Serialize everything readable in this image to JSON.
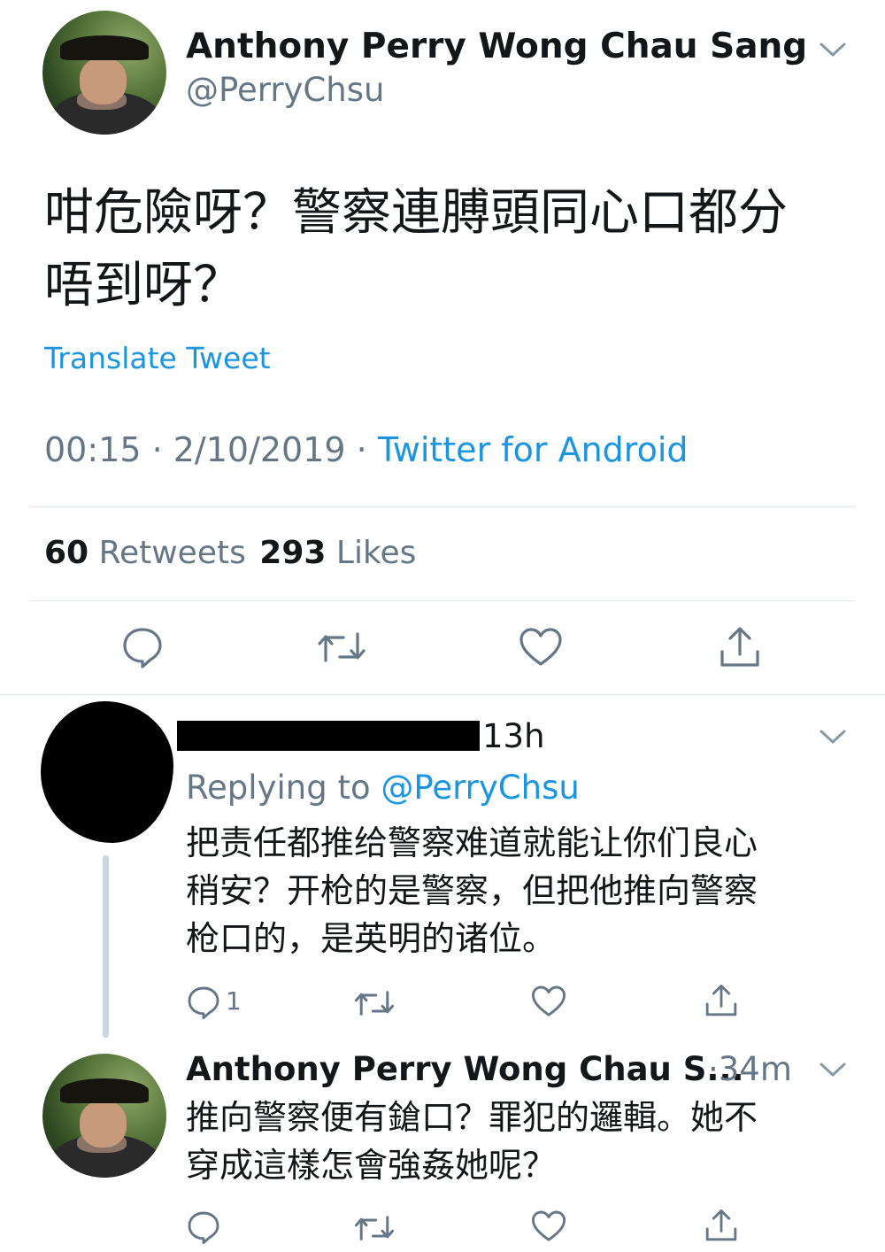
{
  "main_tweet": {
    "author_name": "Anthony Perry Wong Chau Sang",
    "handle": "@PerryChsu",
    "text_line1": "咁危險呀？警察連膊頭同心口都分",
    "text_line2": "唔到呀？",
    "translate_label": "Translate Tweet",
    "timestamp": "00:15 · 2/10/2019 · ",
    "source": "Twitter for Android",
    "retweets_count": "60",
    "retweets_label": "Retweets",
    "likes_count": "293",
    "likes_label": "Likes"
  },
  "reply_1": {
    "time": "13h",
    "replying_to_label": "Replying to ",
    "replying_to_handle": "@PerryChsu",
    "text_line1": "把责任都推给警察难道就能让你们良心",
    "text_line2": "稍安？开枪的是警察，但把他推向警察",
    "text_line3": "枪口的，是英明的诸位。",
    "reply_count": "1"
  },
  "reply_2": {
    "author_name": "Anthony Perry Wong Chau S...",
    "time": "·34m",
    "text_line1": "推向警察便有鎗口？罪犯的邏輯。她不",
    "text_line2": "穿成這樣怎會強姦她呢？"
  },
  "colors": {
    "accent": "#1b95e0",
    "secondary_text": "#657786",
    "icon": "#657786"
  },
  "icons": [
    "chevron-down-icon",
    "reply-icon",
    "retweet-icon",
    "like-icon",
    "share-icon"
  ]
}
